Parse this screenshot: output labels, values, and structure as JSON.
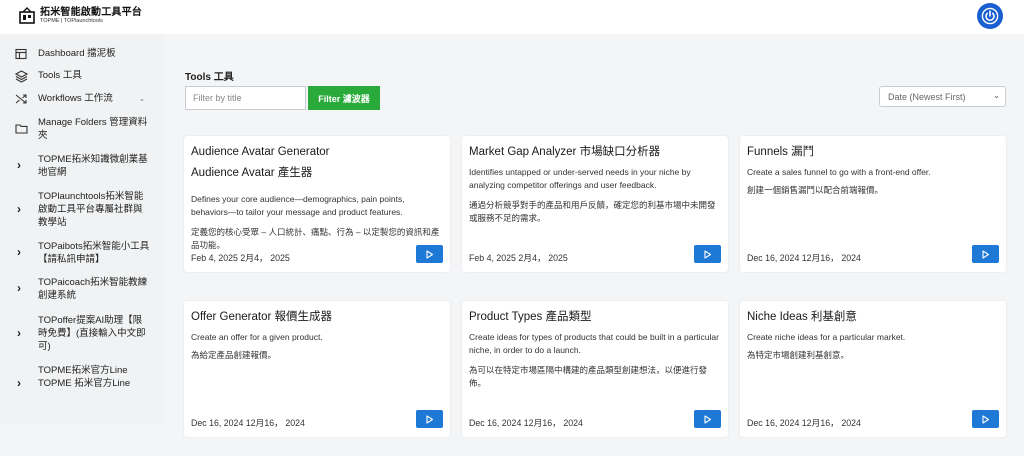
{
  "header": {
    "logo_title": "拓米智能啟動工具平台",
    "logo_subtitle": "TOPME | TOPlaunchtools",
    "power_icon": "power-icon",
    "accent_color": "#1a5fd0"
  },
  "sidebar": {
    "items": [
      {
        "label": "Dashboard 擋泥板",
        "icon": "dashboard-icon"
      },
      {
        "label": "Tools 工具",
        "icon": "layers-icon"
      },
      {
        "label": "Workflows 工作流",
        "icon": "shuffle-icon"
      },
      {
        "label": "Manage Folders 管理資料夾",
        "icon": "folder-icon"
      },
      {
        "label": "TOPME拓米知識微創業基地官網",
        "icon": "chevron-right-icon"
      },
      {
        "label": "TOPlaunchtools拓米智能啟動工具平台專屬社群與教學站",
        "icon": "chevron-right-icon"
      },
      {
        "label": "TOPaibots拓米智能小工具【請私訊申請】",
        "icon": "chevron-right-icon"
      },
      {
        "label": "TOPaicoach拓米智能教練創建系統",
        "icon": "chevron-right-icon"
      },
      {
        "label": "TOPoffer提案AI助理【限時免費】(直接輸入中文即可)",
        "icon": "chevron-right-icon"
      },
      {
        "label": "TOPME拓米官方Line   TOPME 拓米官方Line",
        "icon": "chevron-right-icon"
      }
    ]
  },
  "main": {
    "title": "Tools  工具",
    "filter_placeholder": "Filter by title",
    "filter_button": "Filter  濾波器",
    "filter_button_color": "#2aaa3a",
    "sort_value": "Date (Newest First)"
  },
  "cards": [
    {
      "title": "Audience Avatar Generator",
      "subtitle": "Audience Avatar 產生器",
      "desc": "Defines your core audience—demographics, pain points, behaviors—to tailor your message and product features.",
      "desc_zh": "定義您的核心受眾 – 人口統計、痛點、行為 – 以定製您的資訊和產品功能。",
      "date": "Feb 4, 2025    2月4，  2025"
    },
    {
      "title": "Market Gap Analyzer  市場缺口分析器",
      "subtitle": "",
      "desc": "Identifies untapped or under-served needs in your niche by analyzing competitor offerings and user feedback.",
      "desc_zh": "通過分析競爭對手的產品和用戶反饋，確定您的利基市場中未開發或服務不足的需求。",
      "date": "Feb 4, 2025    2月4，  2025"
    },
    {
      "title": "Funnels  漏鬥",
      "subtitle": "",
      "desc": "Create a sales funnel to go with a front-end offer.",
      "desc_zh": "創建一個銷售漏鬥以配合前端報價。",
      "date": "Dec 16, 2024    12月16，  2024"
    },
    {
      "title": "Offer Generator  報價生成器",
      "subtitle": "",
      "desc": "Create an offer for a given product.",
      "desc_zh": "為給定產品創建報價。",
      "date": "Dec 16, 2024    12月16，  2024"
    },
    {
      "title": "Product Types  產品類型",
      "subtitle": "",
      "desc": "Create ideas for types of products that could be built in a particular niche, in order to do a launch.",
      "desc_zh": "為可以在特定市場區隔中構建的產品類型創建想法，以便進行發佈。",
      "date": "Dec 16, 2024    12月16，  2024"
    },
    {
      "title": "Niche Ideas  利基創意",
      "subtitle": "",
      "desc": "Create niche ideas for a particular market.",
      "desc_zh": "為特定市場創建利基創意。",
      "date": "Dec 16, 2024    12月16，  2024"
    }
  ],
  "colors": {
    "play_button": "#1e78d6"
  }
}
